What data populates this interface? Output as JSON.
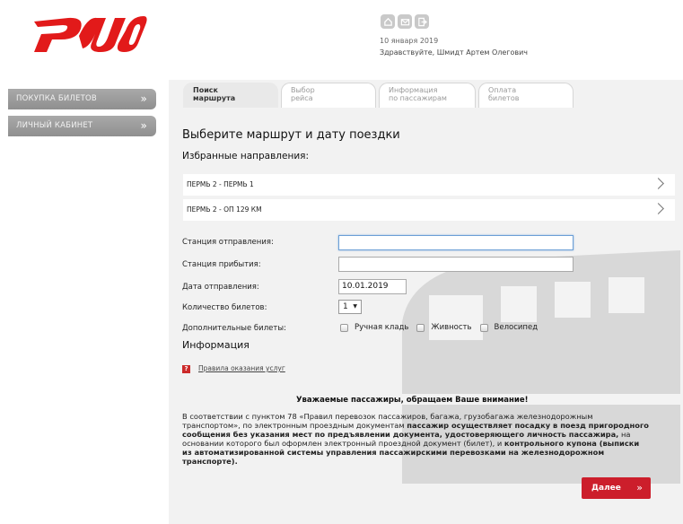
{
  "header": {
    "date": "10 января 2019",
    "greeting": "Здравствуйте, Шмидт Артем Олегович",
    "icons": [
      "home-icon",
      "mail-icon",
      "exit-icon"
    ],
    "brand_color": "#e21a1a"
  },
  "sidebar": {
    "items": [
      {
        "label": "ПОКУПКА БИЛЕТОВ",
        "chevron": "»"
      },
      {
        "label": "ЛИЧНЫЙ КАБИНЕТ",
        "chevron": "»"
      }
    ]
  },
  "tabs": [
    {
      "line1": "Поиск",
      "line2": "маршрута",
      "active": true
    },
    {
      "line1": "Выбор",
      "line2": "рейса",
      "active": false
    },
    {
      "line1": "Информация",
      "line2": "по пассажирам",
      "active": false
    },
    {
      "line1": "Оплата",
      "line2": "билетов",
      "active": false
    }
  ],
  "main": {
    "title": "Выберите маршрут и дату поездки",
    "favorites_title": "Избранные направления:",
    "favorites": [
      "ПЕРМЬ 2 - ПЕРМЬ 1",
      "ПЕРМЬ 2 - ОП 129 КМ"
    ]
  },
  "form": {
    "departure_label": "Станция отправления:",
    "departure_value": "",
    "arrival_label": "Станция прибытия:",
    "arrival_value": "",
    "date_label": "Дата отправления:",
    "date_value": "10.01.2019",
    "count_label": "Количество билетов:",
    "count_value": "1",
    "extra_label": "Дополнительные билеты:",
    "extras": [
      "Ручная кладь",
      "Живность",
      "Велосипед"
    ]
  },
  "info": {
    "title": "Информация",
    "link": "Правила оказания услуг"
  },
  "notice": {
    "heading": "Уважаемые пассажиры, обращаем Ваше внимание!",
    "p1": "В соответствии с пунктом 78 «Правил перевозок пассажиров, багажа, грузобагажа железнодорожным транспортом», по электронным проездным документам ",
    "b1": "пассажир осуществляет посадку в поезд пригородного сообщения без указания мест по предъявлении документа, удостоверяющего личность пассажира,",
    "p2": " на основании которого был оформлен электронный проездной документ (билет), и ",
    "b2": "контрольного купона (выписки из автоматизированной системы управления пассажирскими перевозками на железнодорожном транспорте)."
  },
  "buttons": {
    "next_label": "Далее",
    "next_arrow": "»"
  }
}
